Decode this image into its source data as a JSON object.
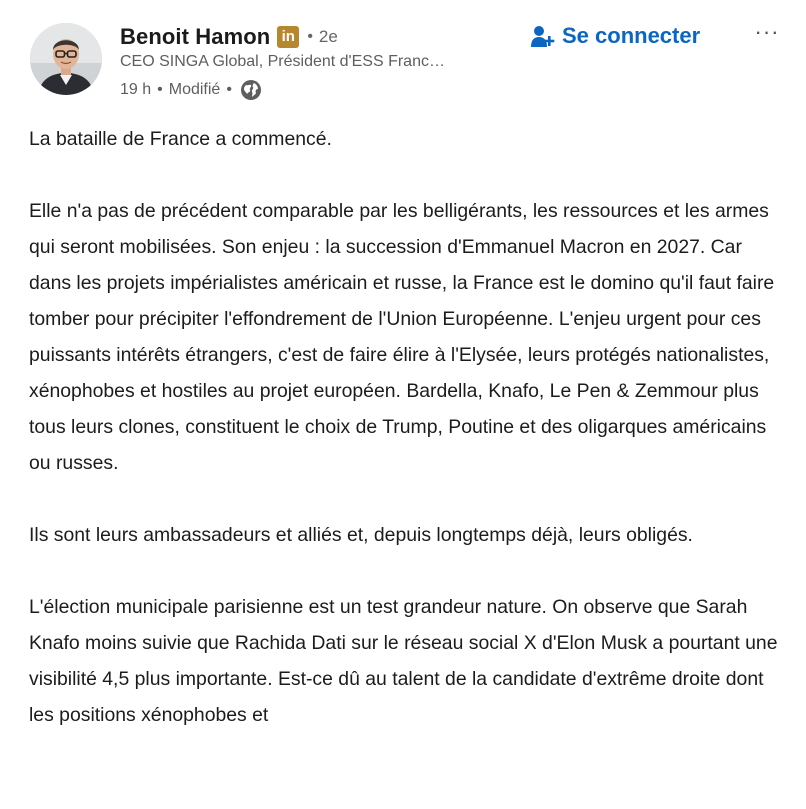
{
  "author": {
    "name": "Benoit Hamon",
    "badge": "in",
    "connection_degree": "2e",
    "headline": "CEO SINGA Global, Président d'ESS Franc…",
    "time": "19 h",
    "edited": "Modifié",
    "visibility_icon": "globe-icon",
    "avatar_icon": "profile-photo"
  },
  "actions": {
    "connect_label": "Se connecter",
    "connect_icon": "person-add-icon",
    "more_label": "···"
  },
  "colors": {
    "accent": "#0a66c2",
    "badge": "#b6872c",
    "secondary_text": "#5e5e5e"
  },
  "post": {
    "paragraphs": [
      "La bataille de France a commencé.",
      "Elle n'a pas de précédent comparable par les belligérants, les ressources et les armes qui seront mobilisées. Son enjeu : la succession d'Emmanuel Macron en 2027. Car dans les projets impérialistes américain et russe, la France est le domino qu'il faut faire tomber pour précipiter l'effondrement de l'Union Européenne. L'enjeu urgent pour ces puissants intérêts étrangers, c'est de faire élire à l'Elysée, leurs protégés nationalistes, xénophobes et hostiles au projet européen. Bardella, Knafo, Le Pen & Zemmour plus tous leurs clones, constituent le choix de Trump, Poutine et des oligarques américains ou russes.",
      "Ils sont leurs ambassadeurs et alliés et, depuis longtemps déjà, leurs obligés.",
      "L'élection municipale parisienne est un test grandeur nature. On observe que Sarah Knafo moins suivie que Rachida Dati sur le réseau social X d'Elon Musk a pourtant une visibilité 4,5 plus importante. Est-ce dû au talent de la candidate d'extrême droite dont les positions xénophobes et"
    ]
  }
}
